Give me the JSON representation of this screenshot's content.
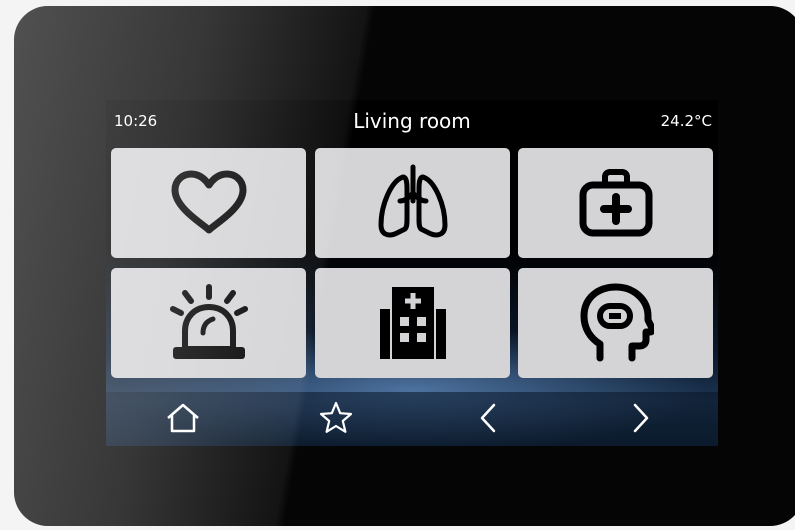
{
  "status": {
    "time": "10:26",
    "room": "Living room",
    "temperature": "24.2°C"
  },
  "tiles": [
    {
      "icon": "heart-icon"
    },
    {
      "icon": "lungs-icon"
    },
    {
      "icon": "first-aid-kit-icon"
    },
    {
      "icon": "alarm-siren-icon"
    },
    {
      "icon": "hospital-building-icon"
    },
    {
      "icon": "head-profile-icon"
    }
  ],
  "nav": [
    {
      "icon": "home-icon"
    },
    {
      "icon": "star-icon"
    },
    {
      "icon": "chevron-left-icon"
    },
    {
      "icon": "chevron-right-icon"
    }
  ],
  "colors": {
    "tile_background": "#d4d4d7",
    "icon": "#000000",
    "text": "#ffffff",
    "bezel": "#050505"
  }
}
